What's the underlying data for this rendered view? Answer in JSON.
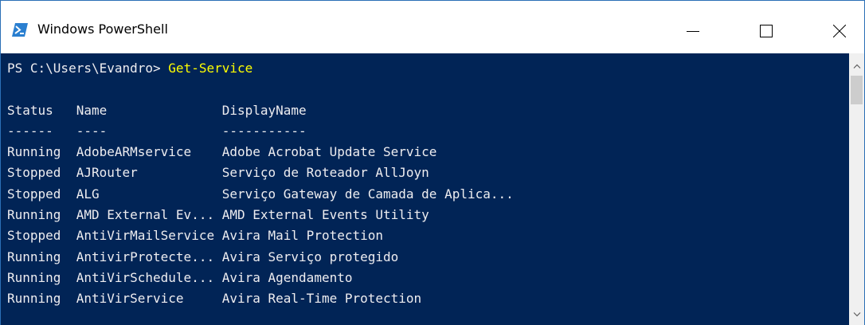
{
  "window": {
    "title": "Windows PowerShell",
    "icon": "powershell-icon",
    "controls": [
      "minimize-icon",
      "maximize-icon",
      "close-icon"
    ]
  },
  "colors": {
    "console_background": "#012456",
    "console_text": "#eeedf0",
    "command_text": "#ffff00"
  },
  "console": {
    "prompt": "PS C:\\Users\\Evandro> ",
    "command": "Get-Service",
    "header": "Status   Name               DisplayName",
    "separator": "------   ----               -----------",
    "rows": [
      "Running  AdobeARMservice    Adobe Acrobat Update Service",
      "Stopped  AJRouter           Serviço de Roteador AllJoyn",
      "Stopped  ALG                Serviço Gateway de Camada de Aplica...",
      "Running  AMD External Ev... AMD External Events Utility",
      "Stopped  AntiVirMailService Avira Mail Protection",
      "Running  AntivirProtecte... Avira Serviço protegido",
      "Running  AntiVirSchedule... Avira Agendamento",
      "Running  AntiVirService     Avira Real-Time Protection"
    ]
  }
}
